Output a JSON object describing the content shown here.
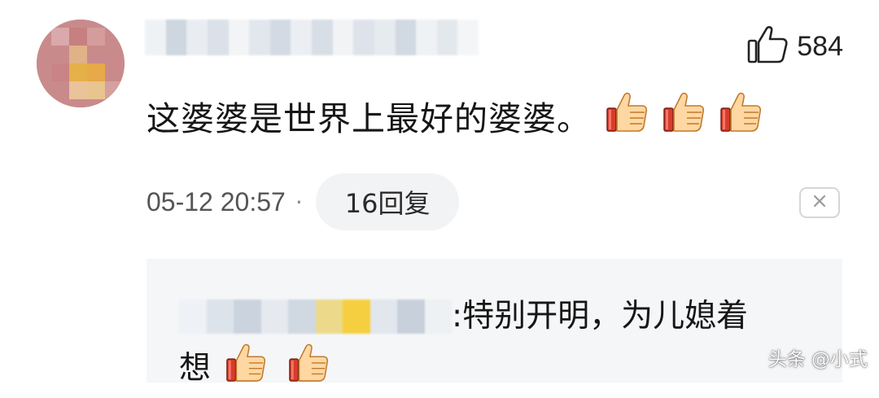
{
  "comment": {
    "like_count": "584",
    "text": "这婆婆是世界上最好的婆婆。",
    "emojis": [
      "thumbs-up",
      "thumbs-up",
      "thumbs-up"
    ],
    "timestamp": "05-12 20:57",
    "separator": "·",
    "replies_label": "16回复"
  },
  "reply": {
    "text_line1": ":特别开明，为儿媳着",
    "text_line2": "想",
    "emojis": [
      "thumbs-up",
      "thumbs-up"
    ]
  },
  "watermark": "头条 @小式",
  "colors": {
    "background": "#ffffff",
    "reply_background": "#f5f6f8",
    "pill_background": "#f2f3f5",
    "text": "#161616",
    "meta_text": "#555555"
  }
}
